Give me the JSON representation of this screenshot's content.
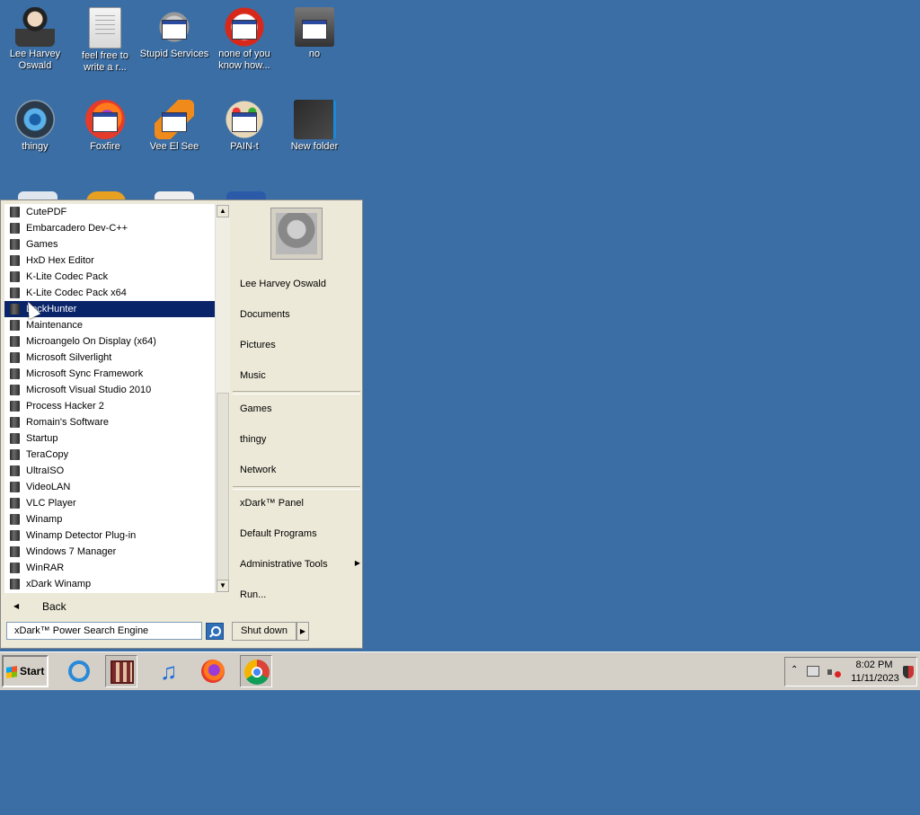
{
  "desktop": {
    "icons": [
      {
        "label": "Lee Harvey Oswald",
        "icon": "anime-character-icon"
      },
      {
        "label": "feel free to write a r...",
        "icon": "text-document-icon"
      },
      {
        "label": "Stupid Services",
        "icon": "services-gear-icon"
      },
      {
        "label": "none of you know how...",
        "icon": "red-circle-app-icon"
      },
      {
        "label": "no",
        "icon": "recycle-bin-icon"
      },
      {
        "label": "thingy",
        "icon": "camera-lens-icon"
      },
      {
        "label": "Foxfire",
        "icon": "firefox-app-icon"
      },
      {
        "label": "Vee El See",
        "icon": "vlc-cone-app-icon"
      },
      {
        "label": "PAIN-t",
        "icon": "paint-palette-app-icon"
      },
      {
        "label": "New folder",
        "icon": "folder-icon"
      }
    ]
  },
  "start_menu": {
    "programs": [
      "CutePDF",
      "Embarcadero Dev-C++",
      "Games",
      "HxD Hex Editor",
      "K-Lite Codec Pack",
      "K-Lite Codec Pack x64",
      "LockHunter",
      "Maintenance",
      "Microangelo On Display (x64)",
      "Microsoft Silverlight",
      "Microsoft Sync Framework",
      "Microsoft Visual Studio 2010",
      "Process Hacker 2",
      "Romain's Software",
      "Startup",
      "TeraCopy",
      "UltraISO",
      "VideoLAN",
      "VLC Player",
      "Winamp",
      "Winamp Detector Plug-in",
      "Windows 7 Manager",
      "WinRAR",
      "xDark Winamp"
    ],
    "selected_program": "LockHunter",
    "back_label": "Back",
    "search_text": "xDark™ Power Search Engine",
    "right_items": {
      "user": "Lee Harvey Oswald",
      "documents": "Documents",
      "pictures": "Pictures",
      "music": "Music",
      "games": "Games",
      "thingy": "thingy",
      "network": "Network",
      "panel": "xDark™ Panel",
      "default_programs": "Default Programs",
      "admin_tools": "Administrative Tools",
      "run": "Run..."
    },
    "shutdown_label": "Shut down"
  },
  "taskbar": {
    "start_label": "Start",
    "pinned": [
      "internet-explorer-icon",
      "media-player-film-icon",
      "itunes-music-icon",
      "firefox-icon",
      "chrome-icon"
    ],
    "tray": {
      "time": "8:02 PM",
      "date": "11/11/2023"
    }
  }
}
